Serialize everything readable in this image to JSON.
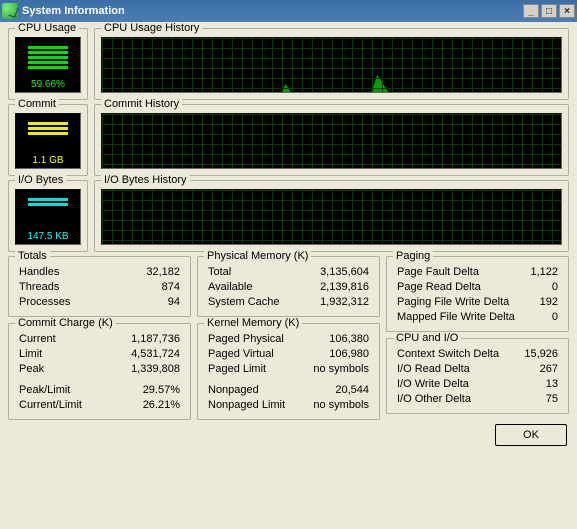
{
  "window": {
    "title": "System Information"
  },
  "cpu": {
    "label": "CPU Usage",
    "value": "59.66%",
    "history_label": "CPU Usage History"
  },
  "commit": {
    "label": "Commit",
    "value": "1.1 GB",
    "history_label": "Commit History"
  },
  "io": {
    "label": "I/O Bytes",
    "value": "147.5 KB",
    "history_label": "I/O Bytes History"
  },
  "totals": {
    "legend": "Totals",
    "handles": {
      "k": "Handles",
      "v": "32,182"
    },
    "threads": {
      "k": "Threads",
      "v": "874"
    },
    "processes": {
      "k": "Processes",
      "v": "94"
    }
  },
  "commit_charge": {
    "legend": "Commit Charge (K)",
    "current": {
      "k": "Current",
      "v": "1,187,736"
    },
    "limit": {
      "k": "Limit",
      "v": "4,531,724"
    },
    "peak": {
      "k": "Peak",
      "v": "1,339,808"
    },
    "peak_limit": {
      "k": "Peak/Limit",
      "v": "29.57%"
    },
    "current_limit": {
      "k": "Current/Limit",
      "v": "26.21%"
    }
  },
  "phys_mem": {
    "legend": "Physical Memory (K)",
    "total": {
      "k": "Total",
      "v": "3,135,604"
    },
    "available": {
      "k": "Available",
      "v": "2,139,816"
    },
    "system_cache": {
      "k": "System Cache",
      "v": "1,932,312"
    }
  },
  "kernel_mem": {
    "legend": "Kernel Memory (K)",
    "paged_physical": {
      "k": "Paged Physical",
      "v": "106,380"
    },
    "paged_virtual": {
      "k": "Paged Virtual",
      "v": "106,980"
    },
    "paged_limit": {
      "k": "Paged Limit",
      "v": "no symbols"
    },
    "nonpaged": {
      "k": "Nonpaged",
      "v": "20,544"
    },
    "nonpaged_limit": {
      "k": "Nonpaged Limit",
      "v": "no symbols"
    }
  },
  "paging": {
    "legend": "Paging",
    "page_fault_delta": {
      "k": "Page Fault Delta",
      "v": "1,122"
    },
    "page_read_delta": {
      "k": "Page Read Delta",
      "v": "0"
    },
    "paging_file_write_delta": {
      "k": "Paging File Write Delta",
      "v": "192"
    },
    "mapped_file_write_delta": {
      "k": "Mapped File Write Delta",
      "v": "0"
    }
  },
  "cpu_io": {
    "legend": "CPU and I/O",
    "context_switch_delta": {
      "k": "Context Switch Delta",
      "v": "15,926"
    },
    "io_read_delta": {
      "k": "I/O Read Delta",
      "v": "267"
    },
    "io_write_delta": {
      "k": "I/O Write Delta",
      "v": "13"
    },
    "io_other_delta": {
      "k": "I/O Other Delta",
      "v": "75"
    }
  },
  "buttons": {
    "ok": "OK"
  }
}
